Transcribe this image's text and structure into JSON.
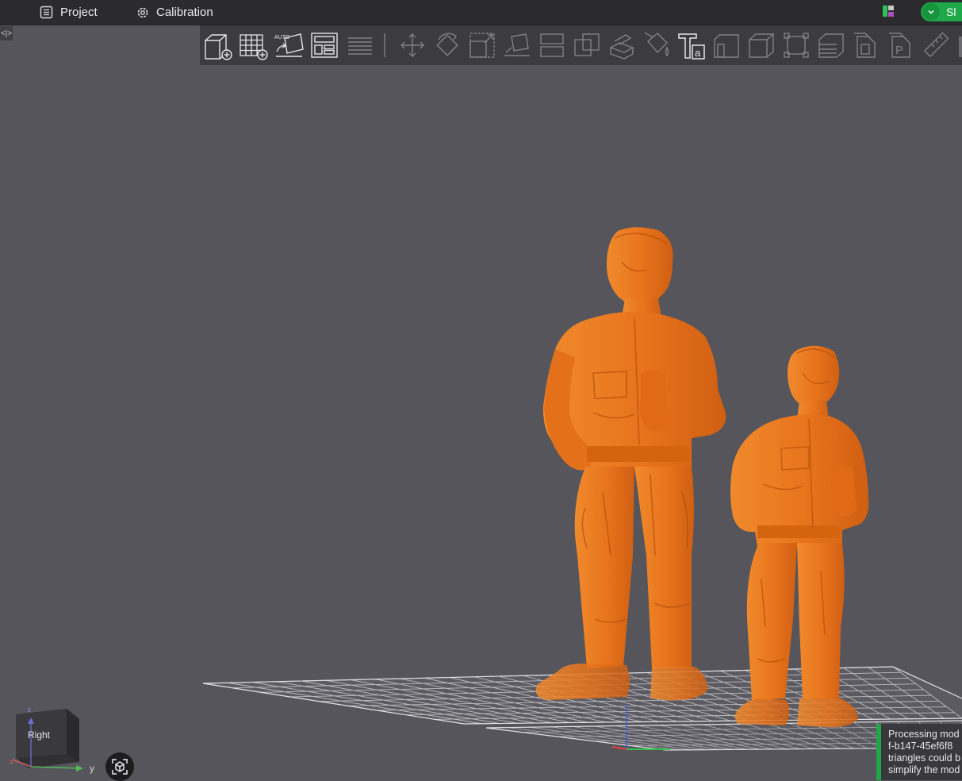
{
  "menu": {
    "project_label": "Project",
    "project_icon": "project-list-icon",
    "calibration_label": "Calibration",
    "calibration_icon": "calibration-gear-icon"
  },
  "top_right": {
    "layout_icon": "layout-toggle-icon",
    "slice_label": "Sl",
    "slice_dropdown_icon": "chevron-down-icon"
  },
  "collapse_handle_label": "<|>",
  "toolbar": {
    "tools": [
      {
        "name": "add-object",
        "icon": "cube-add-icon",
        "enabled": true
      },
      {
        "name": "add-plate",
        "icon": "grid-add-icon",
        "enabled": true
      },
      {
        "name": "auto-orient",
        "icon": "auto-orient-icon",
        "enabled": true
      },
      {
        "name": "arrange",
        "icon": "arrange-icon",
        "enabled": true
      },
      {
        "name": "split-plate",
        "icon": "layers-icon",
        "enabled": false
      },
      {
        "name": "move",
        "icon": "move-icon",
        "enabled": false
      },
      {
        "name": "rotate",
        "icon": "rotate-icon",
        "enabled": false
      },
      {
        "name": "scale",
        "icon": "scale-icon",
        "enabled": false
      },
      {
        "name": "lay-on-face",
        "icon": "lay-on-face-icon",
        "enabled": false
      },
      {
        "name": "split-objects",
        "icon": "split-objects-icon",
        "enabled": false
      },
      {
        "name": "split-parts",
        "icon": "split-parts-icon",
        "enabled": false
      },
      {
        "name": "cut",
        "icon": "cut-icon",
        "enabled": false
      },
      {
        "name": "paint-support",
        "icon": "paint-bucket-icon",
        "enabled": false
      },
      {
        "name": "text",
        "icon": "text-icon",
        "enabled": true
      },
      {
        "name": "seam",
        "icon": "seam-icon",
        "enabled": false
      },
      {
        "name": "boolean",
        "icon": "box-icon",
        "enabled": false
      },
      {
        "name": "measure",
        "icon": "measure-frame-icon",
        "enabled": false
      },
      {
        "name": "variable-layer",
        "icon": "variable-layer-icon",
        "enabled": false
      },
      {
        "name": "emboss",
        "icon": "emboss-icon",
        "enabled": false
      },
      {
        "name": "support",
        "icon": "support-icon",
        "enabled": false
      },
      {
        "name": "ruler",
        "icon": "ruler-icon",
        "enabled": false
      }
    ]
  },
  "view": {
    "cube_face_label": "Right",
    "axis_x_label": "x",
    "axis_y_label": "y",
    "axis_z_label": "z",
    "fit_view_icon": "fit-view-icon"
  },
  "notification": {
    "lines": [
      "Processing mod",
      "f-b147-45ef6f8",
      "triangles could b",
      "simplify the mod"
    ]
  },
  "colors": {
    "model": "#ee7a22",
    "background": "#55555b",
    "toolbar": "#3b3b40",
    "accent": "#1fa84a"
  }
}
